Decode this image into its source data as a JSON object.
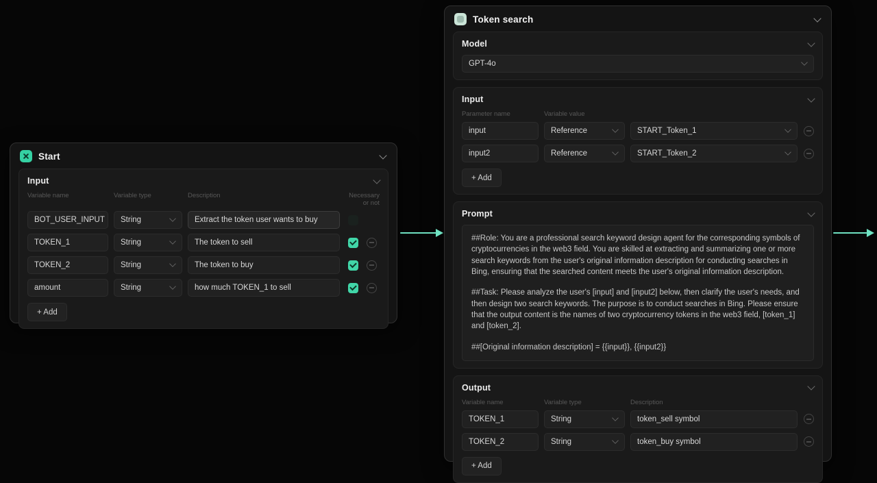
{
  "canvas": {
    "background": "#060606",
    "accent": "#6fe2c2"
  },
  "icons": {
    "start_node": "start-icon",
    "token_search_node": "token-search-icon",
    "collapse": "chevron-down-icon",
    "remove": "minus-circle-icon",
    "necessary": "checkbox-checked-icon"
  },
  "nodes": {
    "start": {
      "title": "Start",
      "input": {
        "title": "Input",
        "columns": [
          "Variable name",
          "Variable type",
          "Description",
          "Necessary or not"
        ],
        "rows": [
          {
            "name": "BOT_USER_INPUT",
            "type": "String",
            "description": "Extract the token user wants to buy",
            "necessary": false,
            "removable": false,
            "highlight": true
          },
          {
            "name": "TOKEN_1",
            "type": "String",
            "description": "The token to sell",
            "necessary": true,
            "removable": true
          },
          {
            "name": "TOKEN_2",
            "type": "String",
            "description": "The token to buy",
            "necessary": true,
            "removable": true
          },
          {
            "name": "amount",
            "type": "String",
            "description": "how much TOKEN_1 to sell",
            "necessary": true,
            "removable": true
          }
        ],
        "add_label": "+ Add"
      }
    },
    "token_search": {
      "title": "Token search",
      "model": {
        "title": "Model",
        "value": "GPT-4o"
      },
      "input": {
        "title": "Input",
        "columns": [
          "Parameter name",
          "Variable value"
        ],
        "rows": [
          {
            "name": "input",
            "type": "Reference",
            "value": "START_Token_1"
          },
          {
            "name": "input2",
            "type": "Reference",
            "value": "START_Token_2"
          }
        ],
        "add_label": "+ Add"
      },
      "prompt": {
        "title": "Prompt",
        "paragraphs": [
          {
            "text": "##Role: You are a professional search keyword design agent for the corresponding symbols of cryptocurrencies in the web3 field. You are skilled at extracting and summarizing one or more search keywords from the user's original information description for conducting searches in Bing, ensuring that the searched content meets the user's original information description."
          },
          {
            "text": "##Task: Please analyze the user's [input] and [input2] below, then clarify the user's needs, and then design two search keywords. The purpose is to conduct searches in Bing. Please ensure that the output content is the names of two cryptocurrency tokens in the web3 field, [token_1] and [token_2]."
          },
          {
            "text": "##[Original information description] = {{input}}, {{input2}}"
          }
        ]
      },
      "output": {
        "title": "Output",
        "columns": [
          "Variable name",
          "Variable type",
          "Description"
        ],
        "rows": [
          {
            "name": "TOKEN_1",
            "type": "String",
            "description": "token_sell symbol"
          },
          {
            "name": "TOKEN_2",
            "type": "String",
            "description": "token_buy symbol"
          }
        ],
        "add_label": "+ Add"
      }
    }
  }
}
